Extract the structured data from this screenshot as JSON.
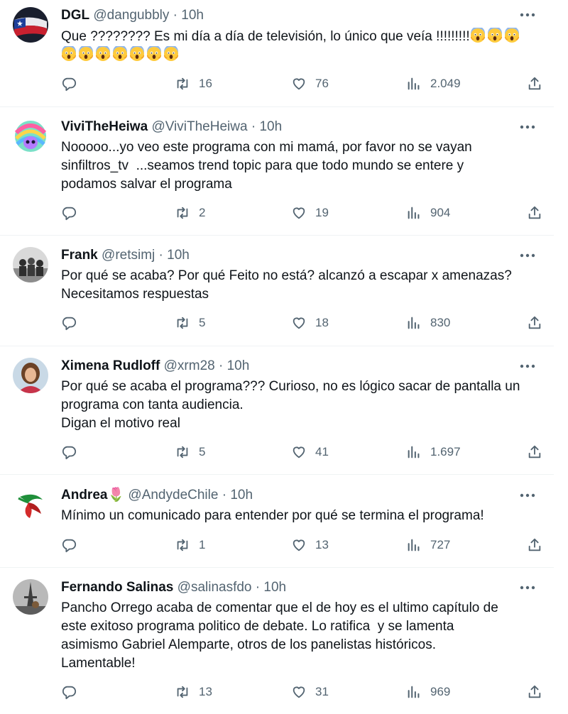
{
  "tweets": [
    {
      "name": "DGL",
      "handle": "@dangubbly",
      "time": "10h",
      "text": "Que ???????? Es mi día a día de televisión, lo único que veía !!!!!!!!!",
      "trailing_emoji": "😱",
      "emoji_count_line1": 3,
      "emoji_count_line2": 7,
      "reply_count": "",
      "retweets": "16",
      "likes": "76",
      "views": "2.049",
      "avatar": "flag"
    },
    {
      "name": "ViviTheHeiwa",
      "handle": "@ViviTheHeiwa",
      "time": "10h",
      "text": "Nooooo...yo veo este programa con mi mamá, por favor no se vayan\nsinfiltros_tv  ...seamos trend topic para que todo mundo se entere y\npodamos salvar el programa",
      "reply_count": "",
      "retweets": "2",
      "likes": "19",
      "views": "904",
      "avatar": "rainbow"
    },
    {
      "name": "Frank",
      "handle": "@retsimj",
      "time": "10h",
      "text": "Por qué se acaba? Por qué Feito no está? alcanzó a escapar x amenazas?\nNecesitamos respuestas",
      "reply_count": "",
      "retweets": "5",
      "likes": "18",
      "views": "830",
      "avatar": "group"
    },
    {
      "name": "Ximena Rudloff",
      "handle": "@xrm28",
      "time": "10h",
      "text": "Por qué se acaba el programa??? Curioso, no es lógico sacar de pantalla un\nprograma con tanta audiencia.\nDigan el motivo real",
      "reply_count": "",
      "retweets": "5",
      "likes": "41",
      "views": "1.697",
      "avatar": "woman"
    },
    {
      "name": "Andrea🌷",
      "handle": "@AndydeChile",
      "time": "10h",
      "text": "Mínimo un comunicado para entender por qué se termina el programa!",
      "reply_count": "",
      "retweets": "1",
      "likes": "13",
      "views": "727",
      "avatar": "logo"
    },
    {
      "name": "Fernando Salinas",
      "handle": "@salinasfdo",
      "time": "10h",
      "text": "Pancho Orrego acaba de comentar que el de hoy es el ultimo capítulo de\neste exitoso programa politico de debate. Lo ratifica  y se lamenta\nasimismo Gabriel Alemparte, otros de los panelistas históricos.\nLamentable!",
      "reply_count": "",
      "retweets": "13",
      "likes": "31",
      "views": "969",
      "avatar": "eiffel"
    }
  ],
  "colors": {
    "text": "#0f1419",
    "secondary": "#536471",
    "divider": "#eff3f4"
  },
  "icons": [
    "more-icon",
    "reply-icon",
    "retweet-icon",
    "like-icon",
    "views-icon",
    "share-icon"
  ]
}
